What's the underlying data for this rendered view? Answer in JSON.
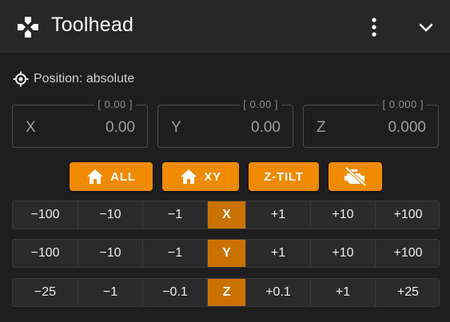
{
  "header": {
    "title": "Toolhead",
    "logo_icon": "gamepad-icon",
    "menu_icon": "more-vertical-icon",
    "collapse_icon": "chevron-down-icon"
  },
  "position_mode": {
    "icon": "crosshairs-gps-icon",
    "label": "Position: absolute"
  },
  "axes": [
    {
      "letter": "X",
      "requested": "[ 0.00 ]",
      "value": "0.00"
    },
    {
      "letter": "Y",
      "requested": "[ 0.00 ]",
      "value": "0.00"
    },
    {
      "letter": "Z",
      "requested": "[ 0.000 ]",
      "value": "0.000"
    }
  ],
  "actions": {
    "home_all": "ALL",
    "home_xy": "XY",
    "z_tilt": "Z-TILT",
    "motors_off_icon": "engine-off-icon"
  },
  "jog": {
    "x": [
      "−100",
      "−10",
      "−1",
      "X",
      "+1",
      "+10",
      "+100"
    ],
    "y": [
      "−100",
      "−10",
      "−1",
      "Y",
      "+1",
      "+10",
      "+100"
    ],
    "z": [
      "−25",
      "−1",
      "−0.1",
      "Z",
      "+0.1",
      "+1",
      "+25"
    ]
  },
  "colors": {
    "accent": "#f08a00",
    "axis_cell": "#c97200",
    "background": "#1e1e1e",
    "header": "#272727"
  }
}
